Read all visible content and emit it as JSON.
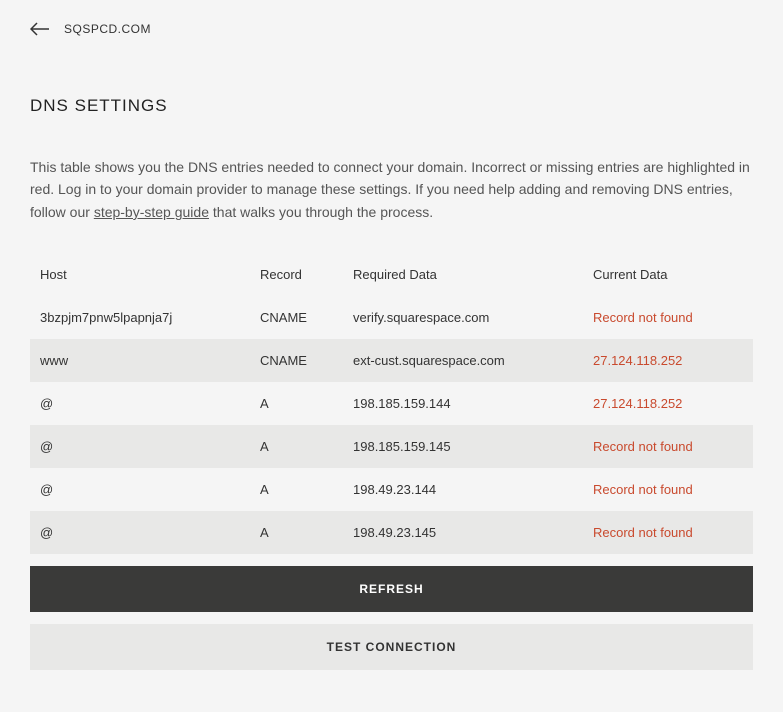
{
  "header": {
    "domain": "SQSPCD.COM"
  },
  "page": {
    "title": "DNS SETTINGS",
    "description_part1": "This table shows you the DNS entries needed to connect your domain. Incorrect or missing entries are highlighted in red. Log in to your domain provider to manage these settings. If you need help adding and removing DNS entries, follow our ",
    "description_link": "step-by-step guide",
    "description_part2": " that walks you through the process."
  },
  "table": {
    "headers": {
      "host": "Host",
      "record": "Record",
      "required": "Required Data",
      "current": "Current Data"
    },
    "rows": [
      {
        "host": "3bzpjm7pnw5lpapnja7j",
        "record": "CNAME",
        "required": "verify.squarespace.com",
        "current": "Record not found",
        "error": true
      },
      {
        "host": "www",
        "record": "CNAME",
        "required": "ext-cust.squarespace.com",
        "current": "27.124.118.252",
        "error": true
      },
      {
        "host": "@",
        "record": "A",
        "required": "198.185.159.144",
        "current": "27.124.118.252",
        "error": true
      },
      {
        "host": "@",
        "record": "A",
        "required": "198.185.159.145",
        "current": "Record not found",
        "error": true
      },
      {
        "host": "@",
        "record": "A",
        "required": "198.49.23.144",
        "current": "Record not found",
        "error": true
      },
      {
        "host": "@",
        "record": "A",
        "required": "198.49.23.145",
        "current": "Record not found",
        "error": true
      }
    ]
  },
  "buttons": {
    "refresh": "REFRESH",
    "test": "TEST CONNECTION"
  }
}
